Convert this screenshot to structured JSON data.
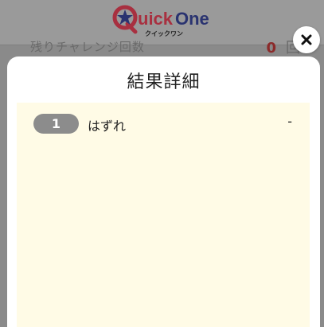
{
  "app": {
    "logo_text": "QuickOne",
    "logo_subtext": "クイックワン"
  },
  "background_row": {
    "label": "残りチャレンジ回数",
    "count": "0",
    "unit": "回"
  },
  "modal": {
    "title": "結果詳細",
    "close_icon": "close-icon",
    "results": [
      {
        "number": "1",
        "label": "はずれ",
        "value": "-"
      }
    ]
  },
  "colors": {
    "overlay": "#8a8a8a",
    "modal_bg": "#ffffff",
    "panel_bg": "#fffbe6",
    "badge_bg": "#8c8c8c",
    "logo_red": "#c8102e",
    "logo_navy": "#1f2a6b"
  }
}
